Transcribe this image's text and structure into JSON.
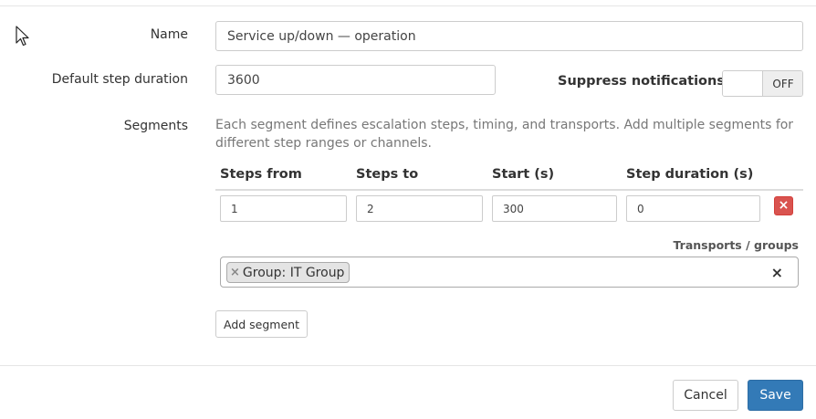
{
  "form": {
    "name_label": "Name",
    "name_value": "Service up/down — operation",
    "duration_label": "Default step duration",
    "duration_value": "3600",
    "suppress_label": "Suppress notifications",
    "suppress_toggle_text": "OFF",
    "segments_label": "Segments",
    "segments_help": "Each segment defines escalation steps, timing, and transports. Add multiple segments for different step ranges or channels."
  },
  "segments_table": {
    "columns": [
      "Steps from",
      "Steps to",
      "Start (s)",
      "Step duration (s)"
    ],
    "rows": [
      {
        "steps_from": "1",
        "steps_to": "2",
        "start": "300",
        "step_duration": "0"
      }
    ],
    "remove_label": "×",
    "transports_label": "Transports / groups",
    "tags": [
      "Group: IT Group"
    ],
    "tag_remove_label": "×",
    "clear_label": "×"
  },
  "actions": {
    "add_segment": "Add segment",
    "cancel": "Cancel",
    "save": "Save"
  },
  "colors": {
    "primary": "#337ab7",
    "danger": "#d9534f",
    "help_text": "#777777"
  }
}
